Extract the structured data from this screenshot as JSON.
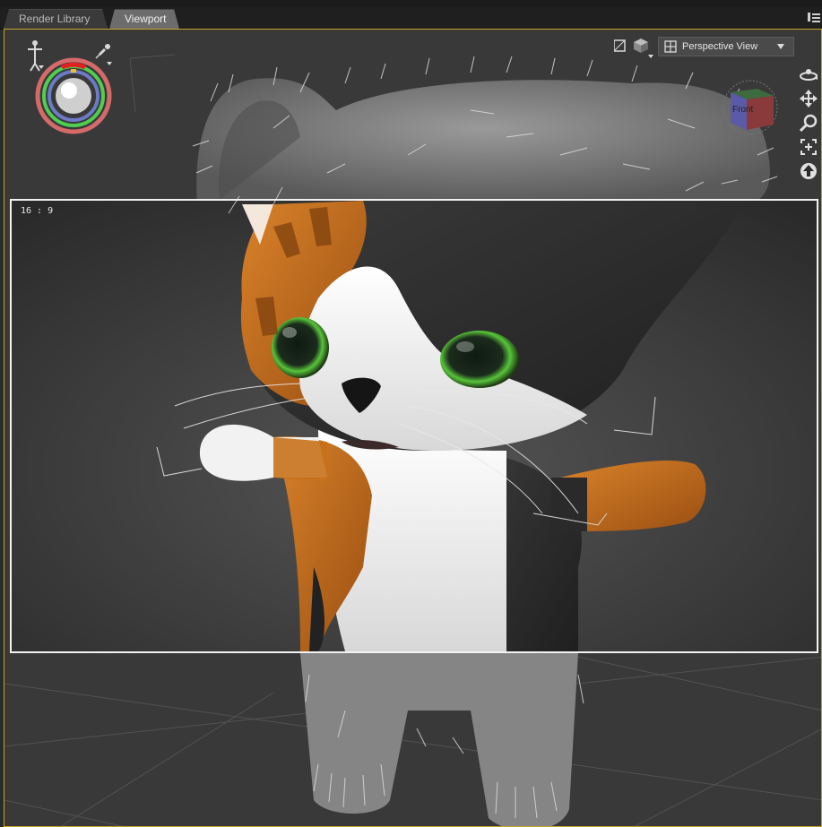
{
  "tabs": [
    {
      "label": "Render Library",
      "active": false
    },
    {
      "label": "Viewport",
      "active": true
    }
  ],
  "viewport": {
    "camera_label": "Perspective View",
    "aspect_ratio": "16 : 9",
    "view_cube_label": "Front"
  },
  "icons": {
    "pose_figure": "figure-pose-icon",
    "pin": "pin-icon",
    "draw_style": "draw-style-icon",
    "cube_menu": "cube-menu-icon",
    "orbit": "orbit-icon",
    "pan": "pan-icon",
    "zoom": "zoom-icon",
    "frame": "frame-icon",
    "up": "up-arrow-icon",
    "panel_menu": "panel-menu-icon"
  },
  "colors": {
    "viewport_border": "#c9a227",
    "gizmo_red": "#e24b4b",
    "gizmo_green": "#4fce4f",
    "gizmo_blue": "#6c7ac8",
    "cat_orange": "#c8711c",
    "cat_black": "#2c2c2c",
    "eye_green": "#58c43a"
  }
}
